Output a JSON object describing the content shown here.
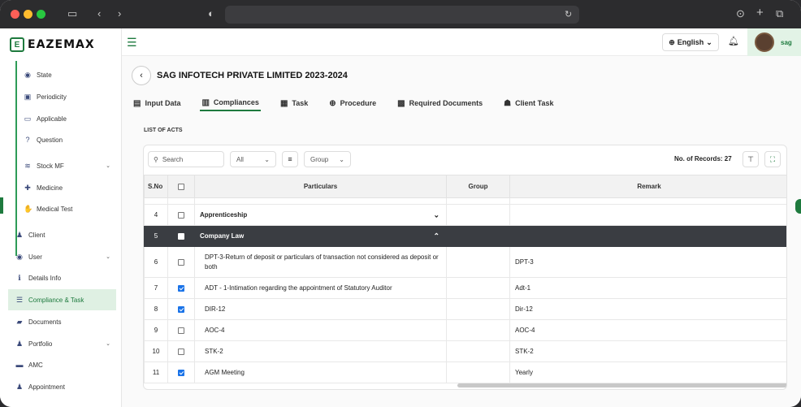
{
  "app": {
    "brand": "EAZEMAX",
    "brand_letter": "E"
  },
  "browser": {
    "back": "‹",
    "forward": "›"
  },
  "sidebar": {
    "items": [
      {
        "label": "State",
        "icon": "user-circle-icon",
        "glyph": "◉"
      },
      {
        "label": "Periodicity",
        "icon": "calendar-icon",
        "glyph": "▣"
      },
      {
        "label": "Applicable",
        "icon": "laptop-icon",
        "glyph": "▭"
      },
      {
        "label": "Question",
        "icon": "question-circle-icon",
        "glyph": "?"
      },
      {
        "label": "Stock MF",
        "icon": "layers-icon",
        "glyph": "≋",
        "chevron": "⌄"
      },
      {
        "label": "Medicine",
        "icon": "medkit-icon",
        "glyph": "✚"
      },
      {
        "label": "Medical Test",
        "icon": "hand-icon",
        "glyph": "✋"
      },
      {
        "label": "Client",
        "icon": "person-icon",
        "glyph": "♟"
      },
      {
        "label": "User",
        "icon": "user-circle-icon",
        "glyph": "◉",
        "chevron": "⌄"
      },
      {
        "label": "Details Info",
        "icon": "info-circle-icon",
        "glyph": "ℹ"
      },
      {
        "label": "Compliance & Task",
        "icon": "list-icon",
        "glyph": "☰"
      },
      {
        "label": "Documents",
        "icon": "folder-icon",
        "glyph": "▰"
      },
      {
        "label": "Portfolio",
        "icon": "person-icon",
        "glyph": "♟",
        "chevron": "⌄"
      },
      {
        "label": "AMC",
        "icon": "card-icon",
        "glyph": "▬"
      },
      {
        "label": "Appointment",
        "icon": "person-icon",
        "glyph": "♟"
      }
    ]
  },
  "topbar": {
    "language": "English",
    "user_name": "sag"
  },
  "page": {
    "title": "SAG INFOTECH PRIVATE LIMITED 2023-2024",
    "tabs": [
      {
        "label": "Input Data",
        "icon": "clipboard-icon",
        "glyph": "▤"
      },
      {
        "label": "Compliances",
        "icon": "book-icon",
        "glyph": "▥"
      },
      {
        "label": "Task",
        "icon": "calendar-icon",
        "glyph": "▦"
      },
      {
        "label": "Procedure",
        "icon": "target-icon",
        "glyph": "⊕"
      },
      {
        "label": "Required Documents",
        "icon": "printer-icon",
        "glyph": "▩"
      },
      {
        "label": "Client Task",
        "icon": "users-icon",
        "glyph": "☗"
      }
    ],
    "section_label": "LIST OF ACTS"
  },
  "toolbar": {
    "search_placeholder": "Search",
    "filter_all": "All",
    "group": "Group",
    "records_label": "No. of Records: 27"
  },
  "table": {
    "headers": {
      "sno": "S.No",
      "particulars": "Particulars",
      "group": "Group",
      "remark": "Remark"
    },
    "rows": [
      {
        "sno": "4",
        "checked": false,
        "particular": "Apprenticeship",
        "group": "",
        "remark": "",
        "type": "group",
        "chevron": "⌄"
      },
      {
        "sno": "5",
        "checked": false,
        "particular": "Company Law",
        "group": "",
        "remark": "",
        "type": "group-open",
        "chevron": "⌃"
      },
      {
        "sno": "6",
        "checked": false,
        "particular": "DPT-3-Return of deposit or particulars of transaction not considered as deposit or both",
        "group": "",
        "remark": "DPT-3",
        "type": "item"
      },
      {
        "sno": "7",
        "checked": true,
        "particular": "ADT - 1-Intimation regarding the appointment of Statutory Auditor",
        "group": "",
        "remark": "Adt-1",
        "type": "item"
      },
      {
        "sno": "8",
        "checked": true,
        "particular": "DIR-12",
        "group": "",
        "remark": "Dir-12",
        "type": "item"
      },
      {
        "sno": "9",
        "checked": false,
        "particular": "AOC-4",
        "group": "",
        "remark": "AOC-4",
        "type": "item"
      },
      {
        "sno": "10",
        "checked": false,
        "particular": "STK-2",
        "group": "",
        "remark": "STK-2",
        "type": "item"
      },
      {
        "sno": "11",
        "checked": true,
        "particular": "AGM Meeting",
        "group": "",
        "remark": "Yearly",
        "type": "item"
      }
    ]
  },
  "colors": {
    "accent": "#1e7a3e",
    "dark_row": "#3a3d42",
    "checkbox": "#1a73e8"
  }
}
